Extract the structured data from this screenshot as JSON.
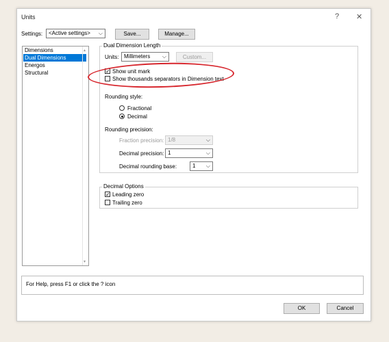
{
  "window": {
    "title": "Units",
    "help_symbol": "?",
    "close_symbol": "✕"
  },
  "settings": {
    "label": "Settings:",
    "selected": "<Active settings>",
    "save_label": "Save...",
    "manage_label": "Manage..."
  },
  "sidebar": {
    "items": [
      {
        "label": "Dimensions",
        "selected": false
      },
      {
        "label": "Dual Dimensions",
        "selected": true
      },
      {
        "label": "Energos",
        "selected": false
      },
      {
        "label": "Structural",
        "selected": false
      }
    ]
  },
  "dual_dimension": {
    "group_title": "Dual Dimension Length",
    "units_label": "Units:",
    "units_value": "Millimeters",
    "custom_label": "Custom...",
    "show_unit_mark": {
      "label": "Show unit mark",
      "checked": true
    },
    "show_thousands": {
      "label": "Show thousands separators in Dimension text",
      "checked": false
    },
    "rounding_style_label": "Rounding style:",
    "rounding_options": [
      {
        "label": "Fractional",
        "selected": false
      },
      {
        "label": "Decimal",
        "selected": true
      }
    ],
    "rounding_precision_label": "Rounding precision:",
    "fraction_precision_label": "Fraction precision:",
    "fraction_precision_value": "1/8",
    "decimal_precision_label": "Decimal precision:",
    "decimal_precision_value": "1",
    "decimal_rounding_base_label": "Decimal rounding base:",
    "decimal_rounding_base_value": "1"
  },
  "decimal_options": {
    "group_title": "Decimal Options",
    "leading_zero": {
      "label": "Leading zero",
      "checked": true
    },
    "trailing_zero": {
      "label": "Trailing zero",
      "checked": false
    }
  },
  "help_text": "For Help, press F1 or click the ? icon",
  "buttons": {
    "ok_label": "OK",
    "cancel_label": "Cancel"
  },
  "colors": {
    "selection": "#0078d7",
    "annotation": "#d7262d"
  }
}
